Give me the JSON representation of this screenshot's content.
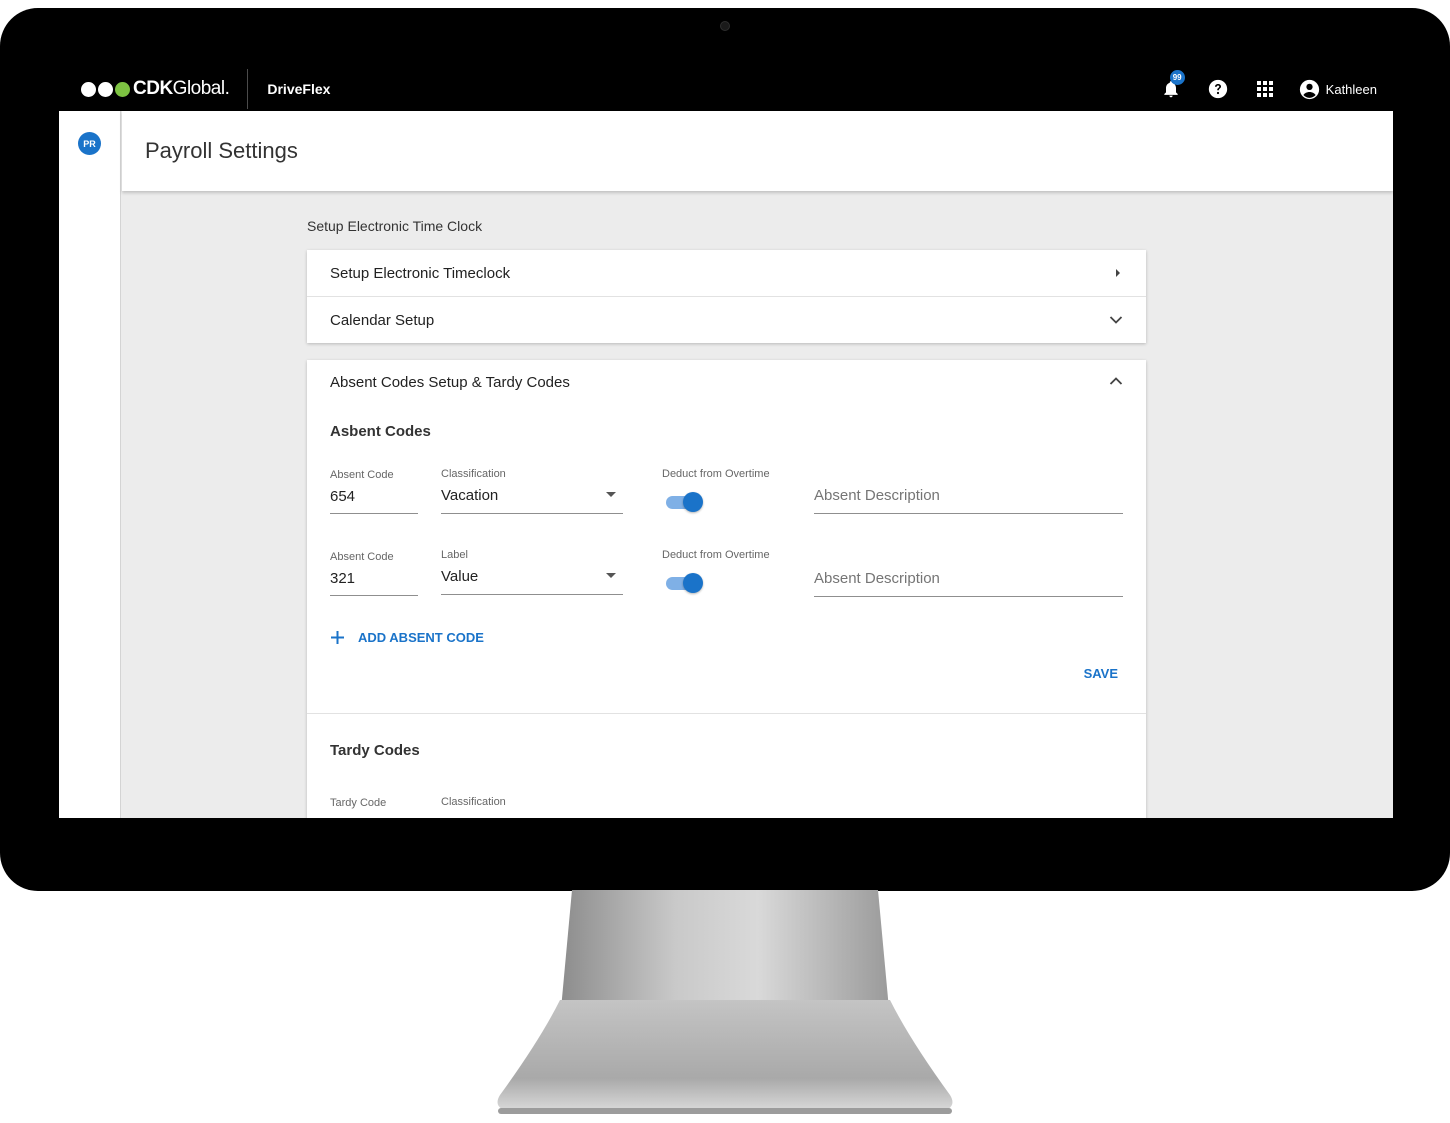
{
  "topbar": {
    "brand_bold": "CDK",
    "brand_rest": "Global",
    "brand_mark": ".",
    "app_name": "DriveFlex",
    "notifications_count": "99",
    "user_name": "Kathleen"
  },
  "sidebar": {
    "badge": "PR"
  },
  "page": {
    "title": "Payroll Settings",
    "section_label": "Setup Electronic Time Clock"
  },
  "accordions": {
    "timeclock": "Setup Electronic Timeclock",
    "calendar": "Calendar Setup",
    "absent_tardy": "Absent Codes Setup & Tardy Codes"
  },
  "absent": {
    "heading": "Asbent Codes",
    "rows": [
      {
        "code_label": "Absent Code",
        "code_value": "654",
        "class_label": "Classification",
        "class_value": "Vacation",
        "deduct_label": "Deduct from Overtime",
        "deduct_on": true,
        "desc_placeholder": "Absent Description"
      },
      {
        "code_label": "Absent Code",
        "code_value": "321",
        "class_label": "Label",
        "class_value": "Value",
        "deduct_label": "Deduct from Overtime",
        "deduct_on": true,
        "desc_placeholder": "Absent Description"
      }
    ],
    "add_label": "ADD ABSENT CODE",
    "save_label": "SAVE"
  },
  "tardy": {
    "heading": "Tardy Codes",
    "code_label": "Tardy Code",
    "class_label": "Classification"
  },
  "colors": {
    "accent": "#1a73c9",
    "toggle_track": "#7fb0e6",
    "logo_green": "#7dc242"
  },
  "icons": [
    "bell-icon",
    "help-icon",
    "apps-grid-icon",
    "account-circle-icon",
    "caret-right-icon",
    "chevron-down-icon",
    "chevron-up-icon",
    "plus-icon",
    "dropdown-caret-icon"
  ]
}
